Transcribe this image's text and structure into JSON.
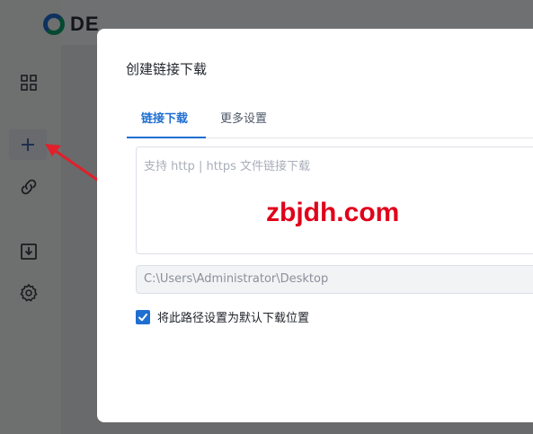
{
  "app": {
    "logo_text": "DE"
  },
  "sidebar": {
    "items": [
      {
        "icon": "grid-icon"
      },
      {
        "icon": "plus-icon",
        "active": true
      },
      {
        "icon": "link-icon"
      },
      {
        "icon": "download-box-icon"
      },
      {
        "icon": "gear-icon"
      }
    ]
  },
  "dialog": {
    "title": "创建链接下载",
    "tabs": [
      {
        "label": "链接下载",
        "active": true
      },
      {
        "label": "更多设置"
      }
    ],
    "url_placeholder": "支持 http | https 文件链接下载",
    "watermark": "zbjdh.com",
    "save_path": "C:\\Users\\Administrator\\Desktop",
    "default_path_checkbox": {
      "label": "将此路径设置为默认下载位置",
      "checked": true
    }
  },
  "colors": {
    "accent": "#1f6fd1",
    "watermark": "#e0001a",
    "annotation_arrow": "#e0202a"
  }
}
